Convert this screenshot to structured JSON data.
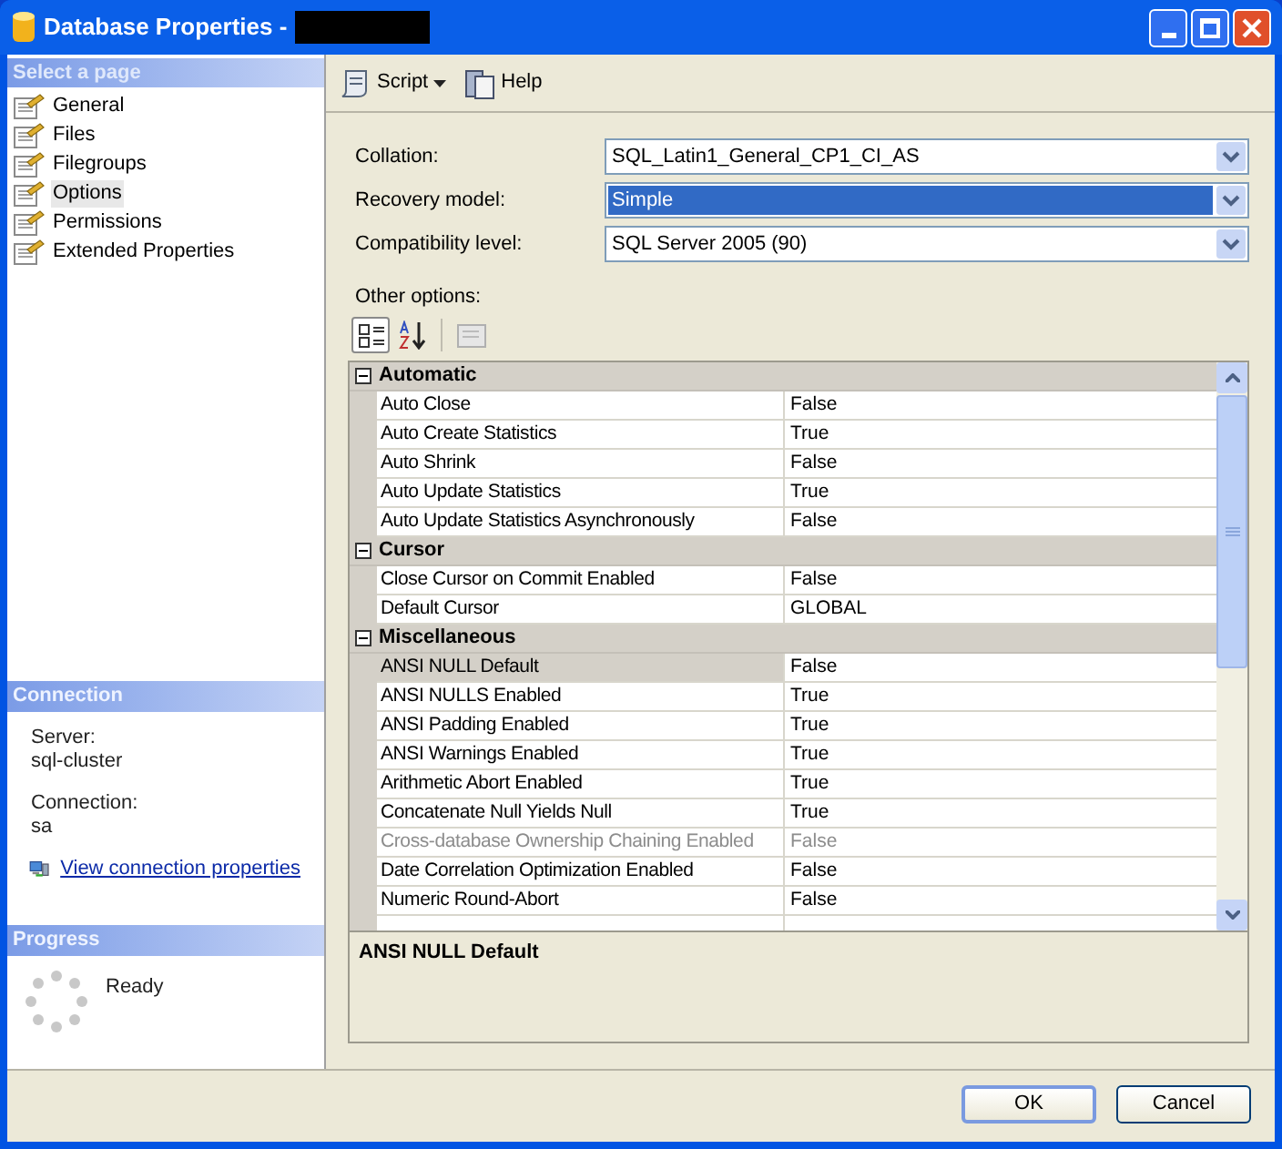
{
  "window": {
    "title": "Database Properties -"
  },
  "sidebar": {
    "header": "Select a page",
    "items": [
      {
        "label": "General",
        "selected": false
      },
      {
        "label": "Files",
        "selected": false
      },
      {
        "label": "Filegroups",
        "selected": false
      },
      {
        "label": "Options",
        "selected": true
      },
      {
        "label": "Permissions",
        "selected": false
      },
      {
        "label": "Extended Properties",
        "selected": false
      }
    ]
  },
  "connection": {
    "header": "Connection",
    "server_label": "Server:",
    "server": "sql-cluster",
    "connection_label": "Connection:",
    "connection": "sa",
    "link": "View connection properties"
  },
  "progress": {
    "header": "Progress",
    "status": "Ready"
  },
  "toolbar": {
    "script": "Script",
    "help": "Help"
  },
  "fields": [
    {
      "label": "Collation:",
      "value": "SQL_Latin1_General_CP1_CI_AS",
      "focused": false
    },
    {
      "label": "Recovery model:",
      "value": "Simple",
      "focused": true
    },
    {
      "label": "Compatibility level:",
      "value": "SQL Server 2005 (90)",
      "focused": false
    }
  ],
  "other_options_label": "Other options:",
  "grid": {
    "categories": [
      {
        "name": "Automatic",
        "expanded": true,
        "rows": [
          {
            "name": "Auto Close",
            "value": "False",
            "selected": false,
            "disabled": false
          },
          {
            "name": "Auto Create Statistics",
            "value": "True",
            "selected": false,
            "disabled": false
          },
          {
            "name": "Auto Shrink",
            "value": "False",
            "selected": false,
            "disabled": false
          },
          {
            "name": "Auto Update Statistics",
            "value": "True",
            "selected": false,
            "disabled": false
          },
          {
            "name": "Auto Update Statistics Asynchronously",
            "value": "False",
            "selected": false,
            "disabled": false
          }
        ]
      },
      {
        "name": "Cursor",
        "expanded": true,
        "rows": [
          {
            "name": "Close Cursor on Commit Enabled",
            "value": "False",
            "selected": false,
            "disabled": false
          },
          {
            "name": "Default Cursor",
            "value": "GLOBAL",
            "selected": false,
            "disabled": false
          }
        ]
      },
      {
        "name": "Miscellaneous",
        "expanded": true,
        "rows": [
          {
            "name": "ANSI NULL Default",
            "value": "False",
            "selected": true,
            "disabled": false
          },
          {
            "name": "ANSI NULLS Enabled",
            "value": "True",
            "selected": false,
            "disabled": false
          },
          {
            "name": "ANSI Padding Enabled",
            "value": "True",
            "selected": false,
            "disabled": false
          },
          {
            "name": "ANSI Warnings Enabled",
            "value": "True",
            "selected": false,
            "disabled": false
          },
          {
            "name": "Arithmetic Abort Enabled",
            "value": "True",
            "selected": false,
            "disabled": false
          },
          {
            "name": "Concatenate Null Yields Null",
            "value": "True",
            "selected": false,
            "disabled": false
          },
          {
            "name": "Cross-database Ownership Chaining Enabled",
            "value": "False",
            "selected": false,
            "disabled": true
          },
          {
            "name": "Date Correlation Optimization Enabled",
            "value": "False",
            "selected": false,
            "disabled": false
          },
          {
            "name": "Numeric Round-Abort",
            "value": "False",
            "selected": false,
            "disabled": false
          }
        ]
      }
    ]
  },
  "description": {
    "title": "ANSI NULL Default"
  },
  "buttons": [
    {
      "label": "OK",
      "default": true
    },
    {
      "label": "Cancel",
      "default": false
    }
  ]
}
